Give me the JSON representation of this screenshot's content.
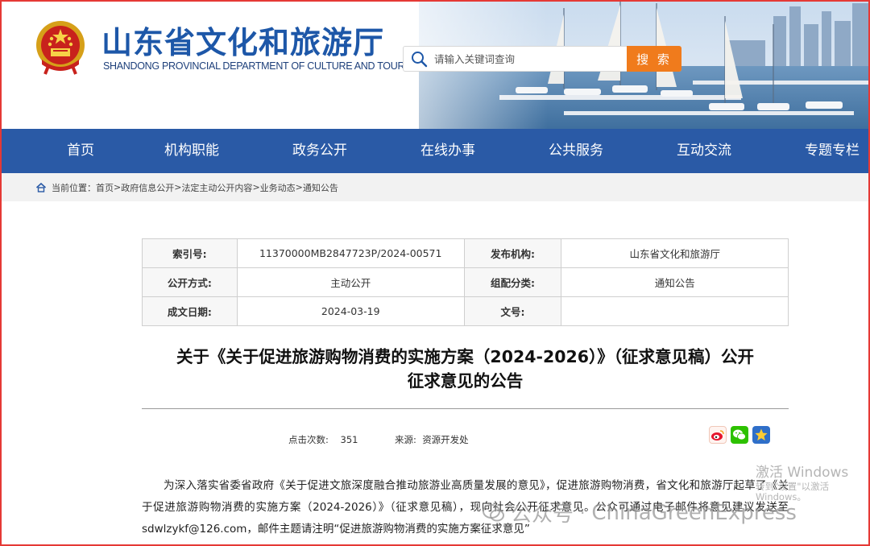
{
  "header": {
    "title": "山东省文化和旅游厅",
    "subtitle": "SHANDONG PROVINCIAL DEPARTMENT OF CULTURE AND TOURISM",
    "emblem_icon": "national-emblem-icon"
  },
  "search": {
    "placeholder": "请输入关键词查询",
    "button_label": "搜 索",
    "button_color": "#f07b1c"
  },
  "nav": {
    "items": [
      "首页",
      "机构职能",
      "政务公开",
      "在线办事",
      "公共服务",
      "互动交流",
      "专题专栏"
    ],
    "background": "#2a5aa6"
  },
  "breadcrumb": {
    "prefix": "当前位置：",
    "items": [
      "首页",
      "政府信息公开",
      "法定主动公开内容",
      "业务动态",
      "通知公告"
    ],
    "separator": ">"
  },
  "info": {
    "index_label": "索引号:",
    "index_value": "11370000MB2847723P/2024-00571",
    "publisher_label": "发布机构:",
    "publisher_value": "山东省文化和旅游厅",
    "disclosure_label": "公开方式:",
    "disclosure_value": "主动公开",
    "category_label": "组配分类:",
    "category_value": "通知公告",
    "date_label": "成文日期:",
    "date_value": "2024-03-19",
    "docno_label": "文号:",
    "docno_value": ""
  },
  "article": {
    "title_line1": "关于《关于促进旅游购物消费的实施方案（2024-2026）》（征求意见稿）公开",
    "title_line2": "征求意见的公告",
    "clicks_label": "点击次数:",
    "clicks_value": "351",
    "source_label": "来源:",
    "source_value": "资源开发处",
    "body": "为深入落实省委省政府《关于促进文旅深度融合推动旅游业高质量发展的意见》，促进旅游购物消费，省文化和旅游厅起草了《关于促进旅游购物消费的实施方案（2024-2026）》（征求意见稿），现向社会公开征求意见。公众可通过电子邮件将意见建议发送至sdwlzykf@126.com，邮件主题请注明“促进旅游购物消费的实施方案征求意见”"
  },
  "share": {
    "icons": [
      "weibo-icon",
      "wechat-icon",
      "favorite-star-icon"
    ]
  },
  "watermarks": {
    "windows_line1": "激活 Windows",
    "windows_line2": "转到\"设置\"以激活 Windows。",
    "channel_prefix": "公众号",
    "channel_name": "ChinaGreenExpress"
  }
}
